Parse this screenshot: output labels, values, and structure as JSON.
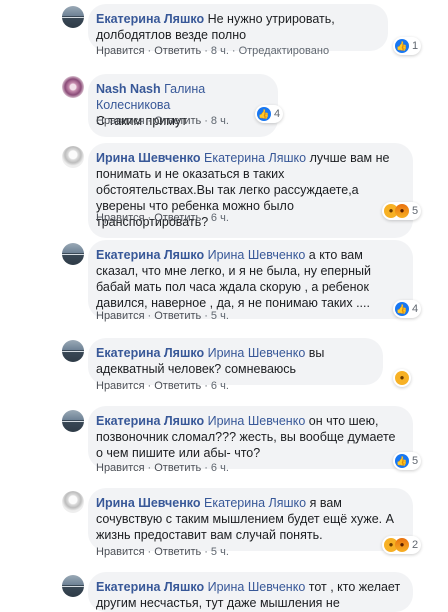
{
  "labels": {
    "like": "Нравится",
    "reply": "Ответить",
    "edited": "Отредактировано",
    "sep": "·"
  },
  "icons": {
    "like": "thumbs-up-icon",
    "haha": "laughing-face-icon",
    "wow": "wow-face-icon",
    "sad": "sad-face-icon",
    "angry": "angry-face-icon"
  },
  "colors": {
    "name": "#385898",
    "bubble": "#f2f3f5",
    "like": "#1877f2",
    "emoji": "#f7b125"
  },
  "comments": [
    {
      "author": "Екатерина Ляшко",
      "mention": "",
      "text": "Не нужно утрировать, долбодятлов везде полно",
      "time": "8 ч.",
      "reactions": "1"
    },
    {
      "author": "Nash Nash",
      "mention": "Галина Колесникова",
      "text": "С таким примут",
      "time": "8 ч.",
      "reactions": "4"
    },
    {
      "author": "Ирина Шевченко",
      "mention": "Екатерина Ляшко",
      "text": "лучше вам не понимать и не оказаться в таких обстоятельствах.Вы так легко рассуждаете,а уверены что ребенка можно было транспортировать?",
      "time": "6 ч.",
      "reactions": "5"
    },
    {
      "author": "Екатерина Ляшко",
      "mention": "Ирина Шевченко",
      "text": "а кто вам сказал, что мне легко, и я не была, ну еперный бабай мать пол часа ждала скорую , а ребенок давился, наверное , да, я не понимаю таких ....",
      "time": "5 ч.",
      "reactions": "4"
    },
    {
      "author": "Екатерина Ляшко",
      "mention": "Ирина Шевченко",
      "text": "вы адекватный человек? сомневаюсь",
      "time": "6 ч.",
      "reactions": ""
    },
    {
      "author": "Екатерина Ляшко",
      "mention": "Ирина Шевченко",
      "text": "он что шею, позвоночник сломал??? жесть, вы вообще думаете о чем пишите или абы- что?",
      "time": "6 ч.",
      "reactions": "5"
    },
    {
      "author": "Ирина Шевченко",
      "mention": "Екатерина Ляшко",
      "text": "я вам сочувствую с таким мышлением будет ещё хуже. А жизнь предоставит вам случай понять.",
      "time": "5 ч.",
      "reactions": "2"
    },
    {
      "author": "Екатерина Ляшко",
      "mention": "Ирина Шевченко",
      "text": "тот , кто желает другим несчастья, тут даже мышления не",
      "time": "",
      "reactions": ""
    }
  ]
}
